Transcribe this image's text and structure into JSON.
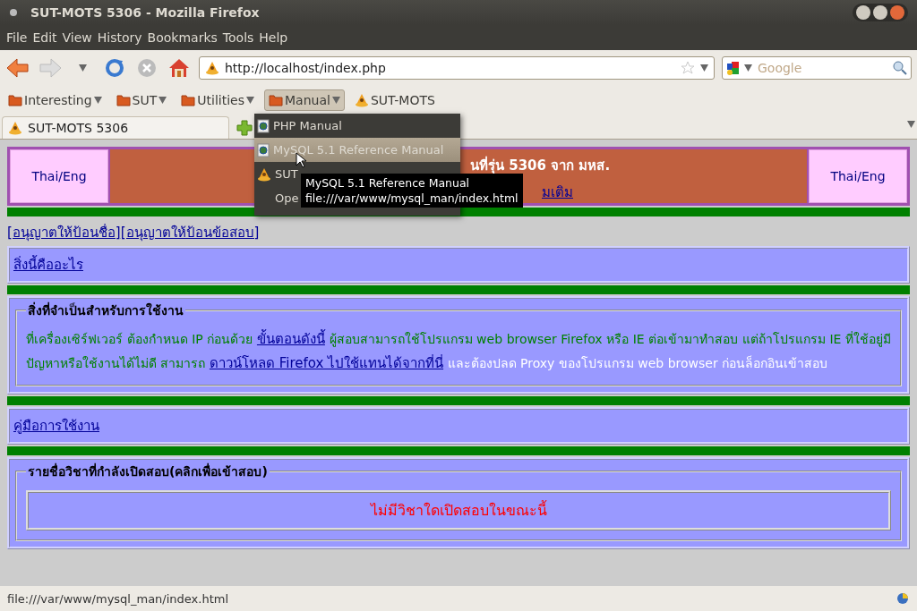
{
  "window": {
    "title": "SUT-MOTS 5306 - Mozilla Firefox"
  },
  "menu_bar": [
    {
      "label": "File"
    },
    {
      "label": "Edit"
    },
    {
      "label": "View"
    },
    {
      "label": "History"
    },
    {
      "label": "Bookmarks"
    },
    {
      "label": "Tools"
    },
    {
      "label": "Help"
    }
  ],
  "address_bar": {
    "value": "http://localhost/index.php"
  },
  "search": {
    "placeholder": "Google"
  },
  "bookmarks": [
    {
      "label": "Interesting",
      "kind": "folder",
      "selected": false
    },
    {
      "label": "SUT",
      "kind": "folder",
      "selected": false
    },
    {
      "label": "Utilities",
      "kind": "folder",
      "selected": false
    },
    {
      "label": "Manual",
      "kind": "folder",
      "selected": true
    },
    {
      "label": "SUT-MOTS",
      "kind": "site",
      "selected": false
    }
  ],
  "tabs": [
    {
      "label": "SUT-MOTS 5306",
      "selected": true
    }
  ],
  "dropdown": [
    {
      "label": "PHP Manual",
      "kind": "page",
      "selected": false
    },
    {
      "label": "MySQL 5.1 Reference Manual",
      "kind": "page",
      "selected": true
    },
    {
      "label": "SUT",
      "kind": "site",
      "selected": false
    },
    {
      "label": "Ope",
      "kind": "plain",
      "selected": false
    }
  ],
  "tooltip": [
    "MySQL 5.1 Reference Manual",
    "file:///var/www/mysql_man/index.html"
  ],
  "banner": {
    "left": "Thai/Eng",
    "heading": "นที่รุ่น 5306 จาก มหส.",
    "link": "มเติม",
    "right": "Thai/Eng"
  },
  "top_links": [
    "[อนุญาตให้ป้อนชื่อ]",
    "[อนุญาตให้ป้อนข้อสอบ]"
  ],
  "about_link": "สิ่งนี้คืออะไร",
  "requirements": {
    "legend": "สิ่งที่จำเป็นสำหรับการใช้งาน",
    "segments": [
      {
        "kind": "text",
        "text": "ที่เครื่องเซิร์ฟเวอร์ ต้องกำหนด IP ก่อนด้วย",
        "color": "#008000"
      },
      {
        "kind": "link",
        "text": "ขั้นตอนดังนี้"
      },
      {
        "kind": "text",
        "text": "ผู้สอบสามารถใช้โปรแกรม web browser Firefox หรือ IE ต่อเข้ามาทำสอบ แต่ถ้าโปรแกรม IE ที่ใช้อยู่มีปัญหาหรือใช้งานได้ไม่ดี สามารถ",
        "color": "#008000"
      },
      {
        "kind": "link",
        "text": "ดาวน์โหลด Firefox ไปใช้แทนได้จากที่นี่"
      },
      {
        "kind": "text",
        "text": "และต้องปลด Proxy ของโปรแกรม web browser ก่อนล็อกอินเข้าสอบ",
        "color": "#ffffff"
      }
    ]
  },
  "manual_link": "คู่มือการใช้งาน",
  "exams": {
    "legend": "รายชื่อวิชาที่กำลังเปิดสอบ(คลิกเพื่อเข้าสอบ)",
    "message": "ไม่มีวิชาใดเปิดสอบในขณะนี้"
  },
  "status_bar": {
    "text": "file:///var/www/mysql_man/index.html"
  }
}
